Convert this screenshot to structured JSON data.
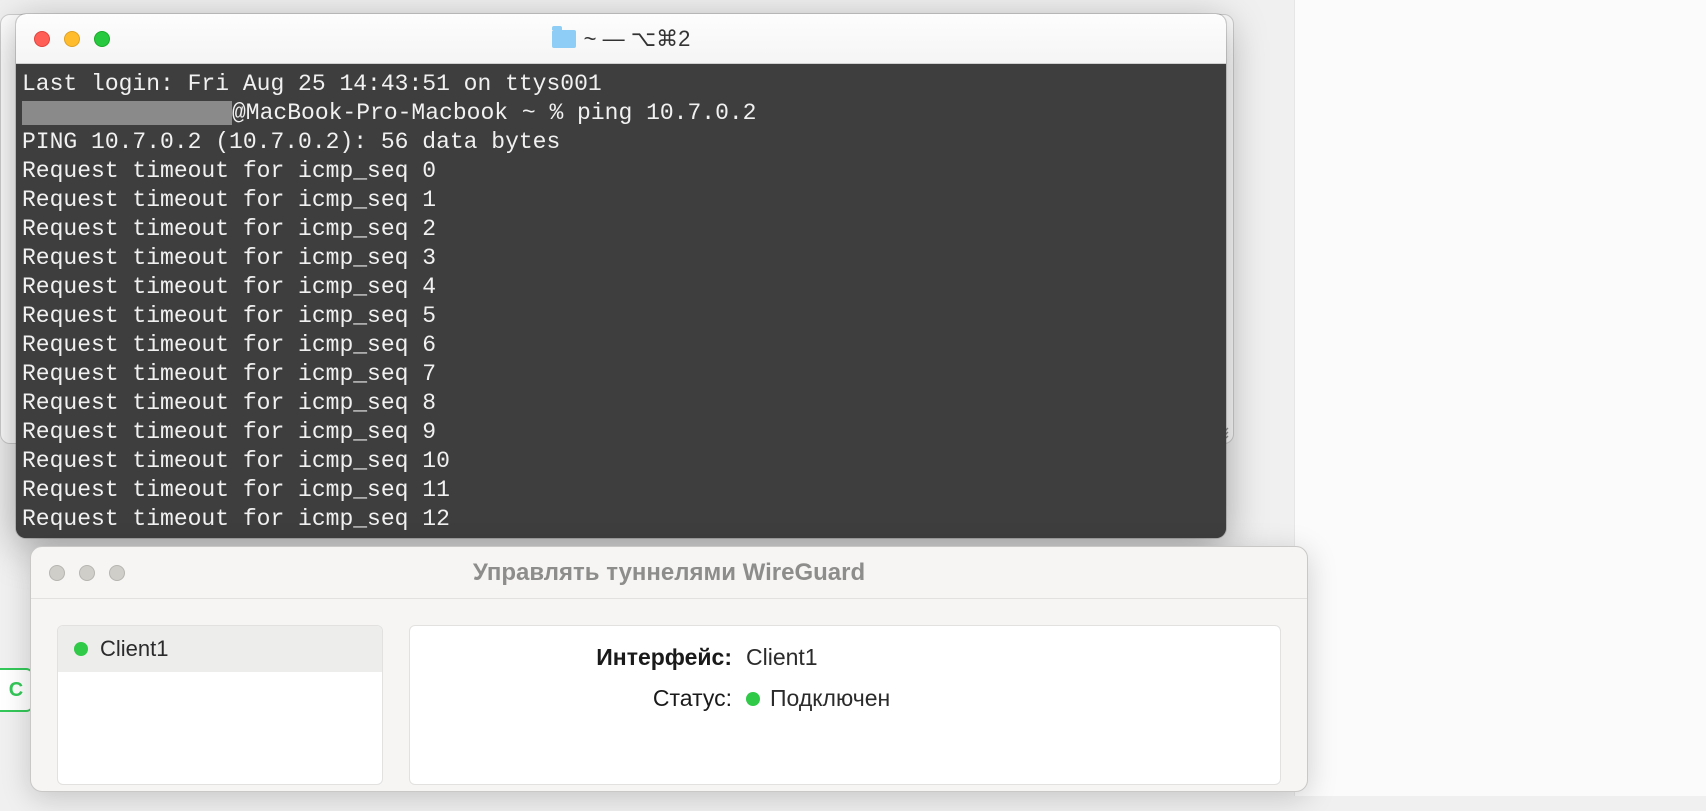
{
  "terminal": {
    "title": "~ — ⌥⌘2",
    "lines": [
      "Last login: Fri Aug 25 14:43:51 on ttys001",
      "@MacBook-Pro-Macbook ~ % ping 10.7.0.2",
      "PING 10.7.0.2 (10.7.0.2): 56 data bytes",
      "Request timeout for icmp_seq 0",
      "Request timeout for icmp_seq 1",
      "Request timeout for icmp_seq 2",
      "Request timeout for icmp_seq 3",
      "Request timeout for icmp_seq 4",
      "Request timeout for icmp_seq 5",
      "Request timeout for icmp_seq 6",
      "Request timeout for icmp_seq 7",
      "Request timeout for icmp_seq 8",
      "Request timeout for icmp_seq 9",
      "Request timeout for icmp_seq 10",
      "Request timeout for icmp_seq 11",
      "Request timeout for icmp_seq 12"
    ],
    "redacted_prefix": true
  },
  "wireguard": {
    "title": "Управлять туннелями WireGuard",
    "sidebar": {
      "items": [
        {
          "name": "Client1",
          "status": "connected"
        }
      ]
    },
    "detail": {
      "interface_label": "Интерфейс:",
      "interface_value": "Client1",
      "status_label": "Статус:",
      "status_value": "Подключен"
    }
  },
  "cutoff_button": "C"
}
